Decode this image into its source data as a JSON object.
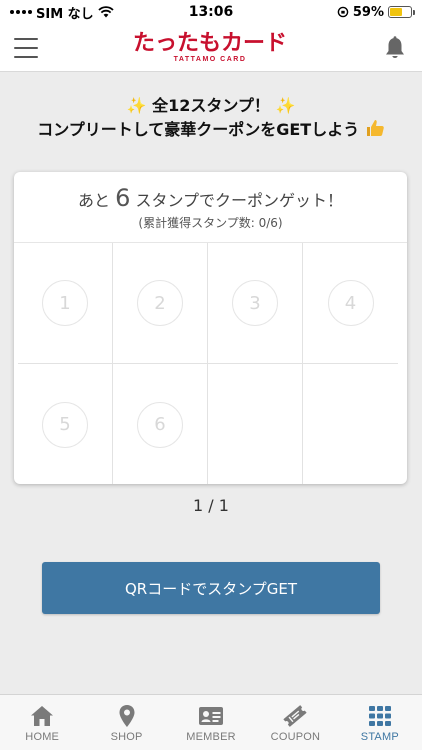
{
  "status_bar": {
    "carrier": "SIM なし",
    "time": "13:06",
    "battery_percent": "59%",
    "battery_level": 0.59
  },
  "header": {
    "logo_text": "たったもカード",
    "logo_subtext": "TATTAMO CARD"
  },
  "intro": {
    "line1": "全12スタンプ！",
    "line2": "コンプリートして豪華クーポンをGETしよう"
  },
  "stamp_card": {
    "remaining_prefix": "あと",
    "remaining_count": "6",
    "remaining_suffix": "スタンプでクーポンゲット！",
    "total_text": "(累計獲得スタンプ数: 0/6)",
    "slots": [
      "1",
      "2",
      "3",
      "4",
      "5",
      "6"
    ]
  },
  "pager": {
    "text": "1 / 1"
  },
  "qr_button": {
    "label": "QRコードでスタンプGET"
  },
  "bottom_nav": {
    "items": [
      {
        "label": "HOME",
        "icon": "home-icon"
      },
      {
        "label": "SHOP",
        "icon": "location-pin-icon"
      },
      {
        "label": "MEMBER",
        "icon": "member-card-icon"
      },
      {
        "label": "COUPON",
        "icon": "ticket-icon"
      },
      {
        "label": "STAMP",
        "icon": "grid-icon"
      }
    ],
    "active": "STAMP"
  },
  "colors": {
    "brand_red": "#c8102e",
    "accent_blue": "#3f77a3",
    "background": "#ececec"
  }
}
